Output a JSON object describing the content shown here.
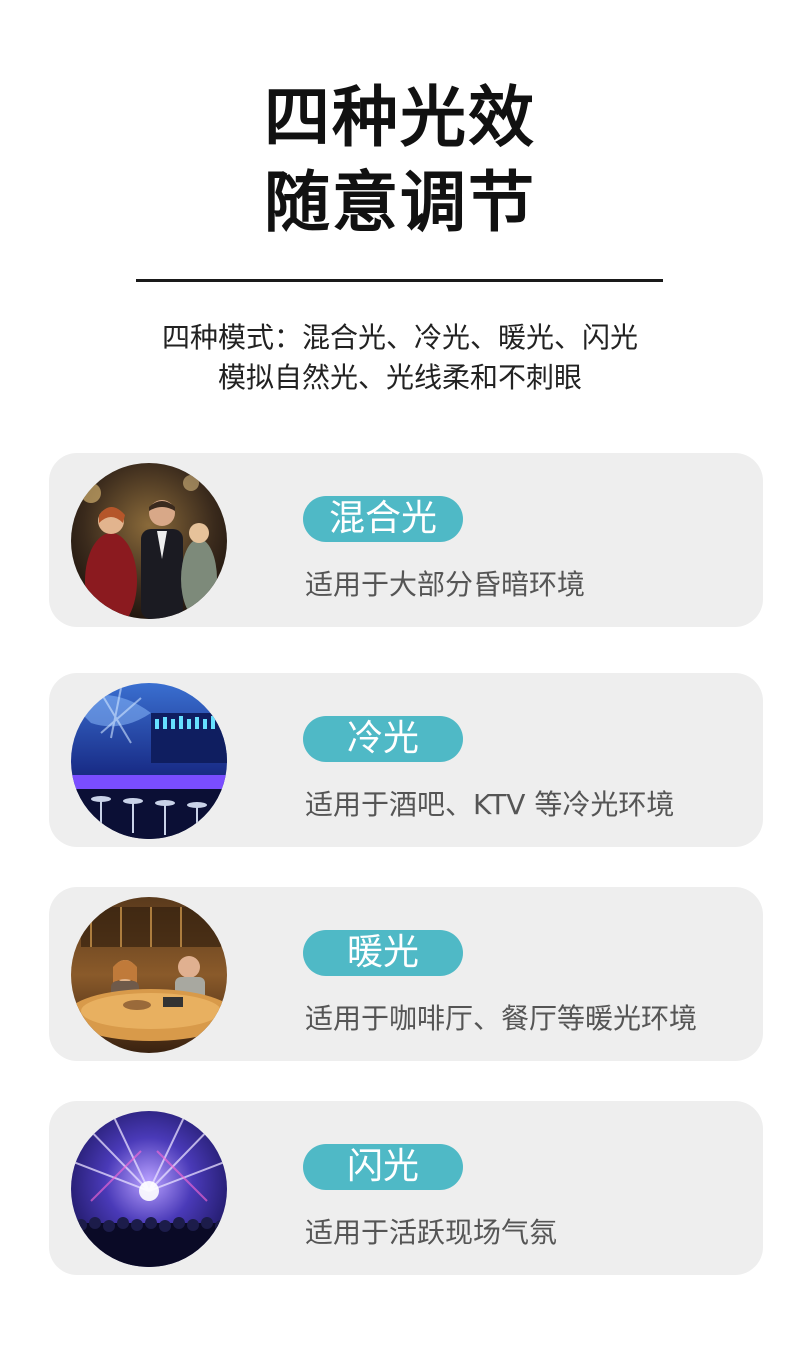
{
  "header": {
    "title_line1": "四种光效",
    "title_line2": "随意调节",
    "subtitle_line1": "四种模式：混合光、冷光、暖光、闪光",
    "subtitle_line2": "模拟自然光、光线柔和不刺眼"
  },
  "modes": [
    {
      "label": "混合光",
      "description": "适用于大部分昏暗环境",
      "image": "party-people-photo"
    },
    {
      "label": "冷光",
      "description": "适用于酒吧、KTV 等冷光环境",
      "image": "blue-bar-photo"
    },
    {
      "label": "暖光",
      "description": "适用于咖啡厅、餐厅等暖光环境",
      "image": "cafe-photo"
    },
    {
      "label": "闪光",
      "description": "适用于活跃现场气氛",
      "image": "concert-stage-photo"
    }
  ],
  "colors": {
    "accent": "#4fb9c6",
    "card_bg": "#eeeeee"
  }
}
